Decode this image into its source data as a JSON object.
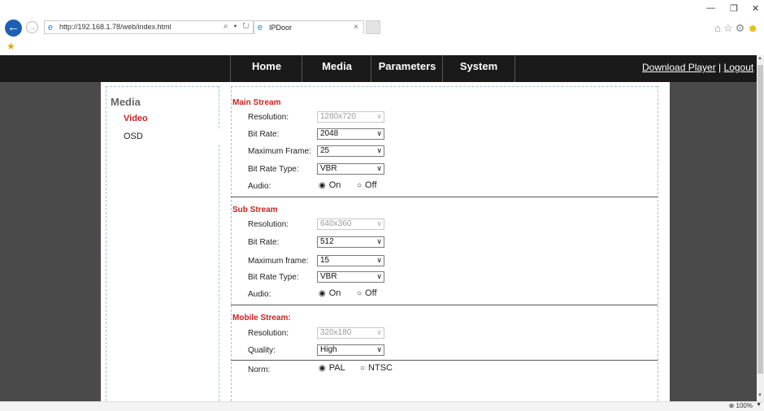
{
  "browser": {
    "url": "http://192.168.1.78/web/index.html",
    "address_tools": "⌕ ▾ ↻",
    "tab_title": "IPDoor",
    "tab_close": "×",
    "zoom": "100%"
  },
  "nav": {
    "items": [
      "Home",
      "Media",
      "Parameters",
      "System"
    ],
    "download_player": "Download Player",
    "separator": " | ",
    "logout": "Logout"
  },
  "sidebar": {
    "heading": "Media",
    "items": [
      "Video",
      "OSD"
    ],
    "active_item": "Video"
  },
  "main_stream": {
    "title": "Main Stream",
    "resolution_label": "Resolution:",
    "resolution": "1280x720",
    "bitrate_label": "Bit Rate:",
    "bitrate": "2048",
    "frame_label": "Maximum Frame:",
    "frame": "25",
    "bitrate_type_label": "Bit Rate Type:",
    "bitrate_type": "VBR",
    "audio_label": "Audio:",
    "audio_on": "On",
    "audio_off": "Off",
    "audio_selected": "On"
  },
  "sub_stream": {
    "title": "Sub Stream",
    "resolution_label": "Resolution:",
    "resolution": "640x360",
    "bitrate_label": "Bit Rate:",
    "bitrate": "512",
    "frame_label": "Maximum frame:",
    "frame": "15",
    "bitrate_type_label": "Bit Rate Type:",
    "bitrate_type": "VBR",
    "audio_label": "Audio:",
    "audio_on": "On",
    "audio_off": "Off",
    "audio_selected": "On"
  },
  "mobile_stream": {
    "title": "Mobile Stream:",
    "resolution_label": "Resolution:",
    "resolution": "320x180",
    "quality_label": "Quality:",
    "quality": "High"
  },
  "norm": {
    "label": "Norm:",
    "pal": "PAL",
    "ntsc": "NTSC",
    "selected": "PAL"
  },
  "colors": {
    "accent_red": "#cc2222",
    "nav_bg": "#1a1a1a",
    "page_bg": "#4a4a4a"
  }
}
